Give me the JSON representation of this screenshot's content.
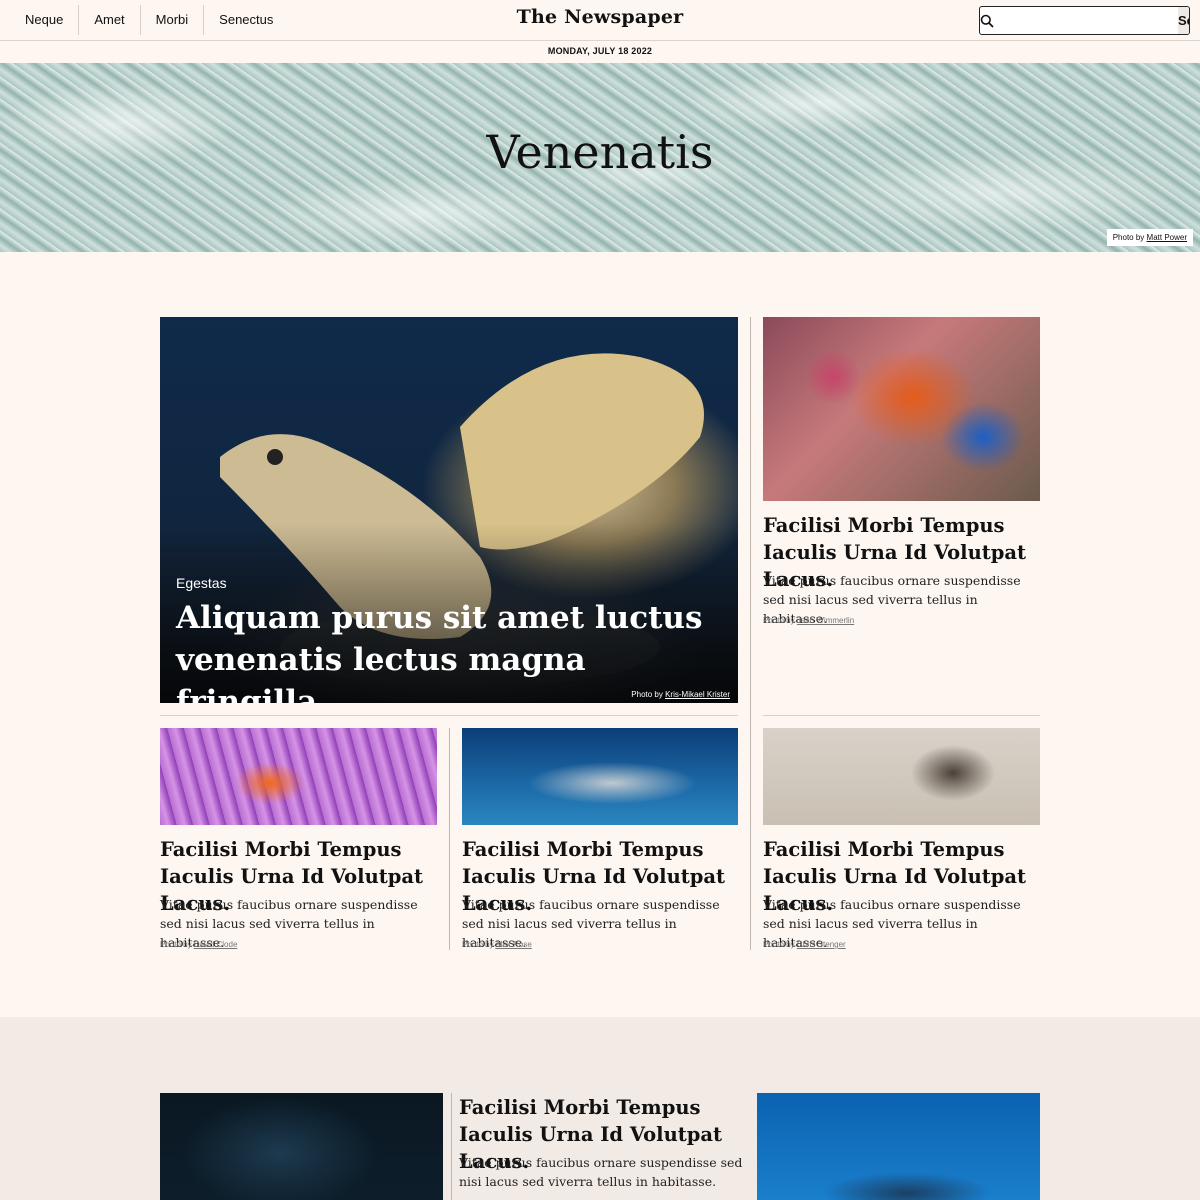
{
  "nav": {
    "items": [
      "Neque",
      "Amet",
      "Morbi",
      "Senectus"
    ]
  },
  "brand": "The Newspaper",
  "search": {
    "placeholder": "",
    "button_label": "Search"
  },
  "date": "MONDAY, JULY 18 2022",
  "hero": {
    "title": "Venenatis",
    "credit_prefix": "Photo by",
    "credit_name": "Matt Power"
  },
  "featured": {
    "kicker": "Egestas",
    "headline": "Aliquam purus sit amet luctus venenatis lectus magna fringilla.",
    "credit_prefix": "Photo by",
    "credit_name": "Kris-Mikael Krister"
  },
  "articles": [
    {
      "title": "Facilisi Morbi Tempus Iaculis Urna Id Volutpat Lacus.",
      "text": "Vitae purus faucibus ornare suspendisse sed nisi lacus sed viverra tellus in habitasse.",
      "credit_prefix": "Photo by",
      "credit_name": "Jean Wimmerlin",
      "image": "mandarin-fish"
    },
    {
      "title": "Facilisi Morbi Tempus Iaculis Urna Id Volutpat Lacus.",
      "text": "Vitae purus faucibus ornare suspendisse sed nisi lacus sed viverra tellus in habitasse.",
      "credit_prefix": "Photo by",
      "credit_name": "David Clode",
      "image": "clownfish"
    },
    {
      "title": "Facilisi Morbi Tempus Iaculis Urna Id Volutpat Lacus.",
      "text": "Vitae purus faucibus ornare suspendisse sed nisi lacus sed viverra tellus in habitasse.",
      "credit_prefix": "Photo by",
      "credit_name": "Alex Rose",
      "image": "shark"
    },
    {
      "title": "Facilisi Morbi Tempus Iaculis Urna Id Volutpat Lacus.",
      "text": "Vitae purus faucibus ornare suspendisse sed nisi lacus sed viverra tellus in habitasse.",
      "credit_prefix": "Photo by",
      "credit_name": "Chris Stenger",
      "image": "seal"
    }
  ],
  "section2": {
    "article": {
      "title": "Facilisi Morbi Tempus Iaculis Urna Id Volutpat Lacus.",
      "text": "Vitae purus faucibus ornare suspendisse sed nisi lacus sed viverra tellus in habitasse."
    },
    "images": [
      "jellyfish",
      "whale-shark"
    ]
  },
  "colors": {
    "background": "#fdf6f1",
    "section_background": "#f2eae4",
    "text": "#111111"
  }
}
